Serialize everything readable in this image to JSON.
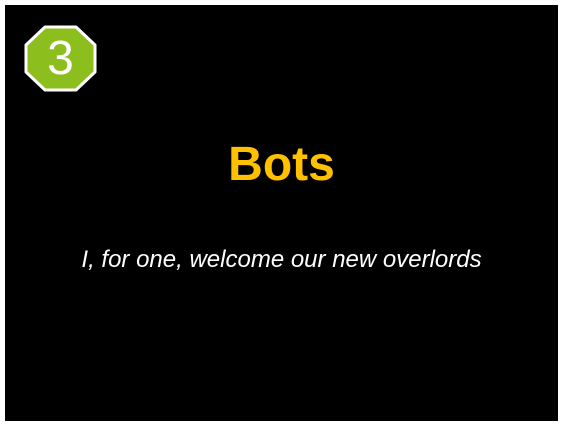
{
  "slide": {
    "number": "3",
    "title": "Bots",
    "subtitle": "I, for one, welcome our new overlords",
    "badge_icon": "octagon-badge-icon"
  },
  "colors": {
    "background": "#000000",
    "title": "#ffc000",
    "subtitle": "#ffffff",
    "badge_fill": "#8cbe1e",
    "badge_border": "#ffffff"
  }
}
